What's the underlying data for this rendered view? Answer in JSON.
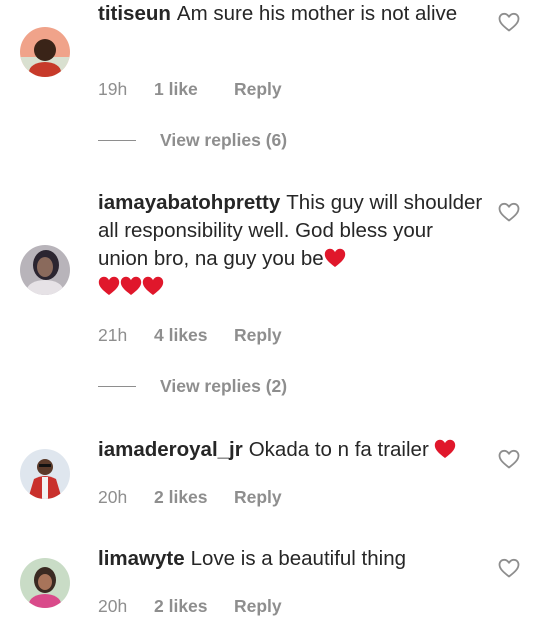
{
  "comments": [
    {
      "username": "titiseun",
      "text": "Am sure his mother is not alive",
      "time": "19h",
      "likes": "1 like",
      "reply": "Reply",
      "view_replies": "View replies (6)"
    },
    {
      "username": "iamayabatohpretty",
      "text": "This guy will shoulder all responsibility well. God bless your union bro, na guy you be",
      "time": "21h",
      "likes": "4 likes",
      "reply": "Reply",
      "view_replies": "View replies (2)"
    },
    {
      "username": "iamaderoyal_jr",
      "text": "Okada to n fa trailer",
      "time": "20h",
      "likes": "2 likes",
      "reply": "Reply"
    },
    {
      "username": "limawyte",
      "text": "Love is a beautiful thing",
      "time": "20h",
      "likes": "2 likes",
      "reply": "Reply"
    }
  ],
  "colors": {
    "text": "#262626",
    "muted": "#8e8e8e",
    "heart_emoji": "#e0172b"
  }
}
